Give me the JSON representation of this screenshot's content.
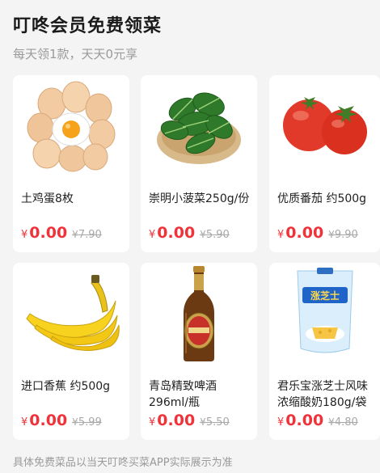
{
  "header": {
    "title": "叮咚会员免费领菜",
    "subtitle": "每天领1款，天天0元享"
  },
  "currency": "¥",
  "products": [
    {
      "name": "土鸡蛋8枚",
      "price": "0.00",
      "original_price": "7.90",
      "icon": "eggs-icon"
    },
    {
      "name": "崇明小菠菜250g/份",
      "price": "0.00",
      "original_price": "5.90",
      "icon": "spinach-icon"
    },
    {
      "name": "优质番茄 约500g",
      "price": "0.00",
      "original_price": "9.90",
      "icon": "tomato-icon"
    },
    {
      "name": "进口香蕉 约500g",
      "price": "0.00",
      "original_price": "5.99",
      "icon": "banana-icon"
    },
    {
      "name": "青岛精致啤酒\n296ml/瓶",
      "price": "0.00",
      "original_price": "5.50",
      "icon": "beer-bottle-icon"
    },
    {
      "name": "君乐宝涨芝士风味\n浓缩酸奶180g/袋",
      "price": "0.00",
      "original_price": "4.80",
      "icon": "yogurt-pouch-icon",
      "package_text": "涨芝士"
    }
  ],
  "footer": {
    "note": "具体免费菜品以当天叮咚买菜APP实际展示为准"
  }
}
